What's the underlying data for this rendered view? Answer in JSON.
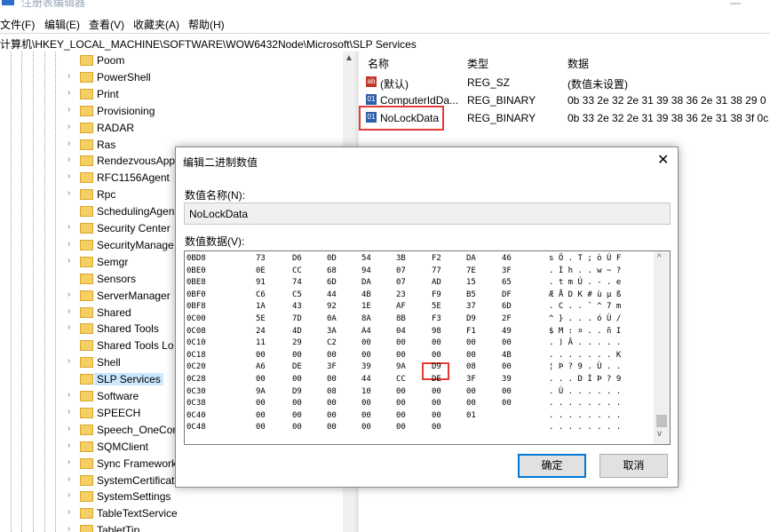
{
  "window": {
    "title": "注册表编辑器"
  },
  "menu": [
    "文件(F)",
    "编辑(E)",
    "查看(V)",
    "收藏夹(A)",
    "帮助(H)"
  ],
  "address": "计算机\\HKEY_LOCAL_MACHINE\\SOFTWARE\\WOW6432Node\\Microsoft\\SLP Services",
  "tree": {
    "items": [
      {
        "label": "Poom",
        "expand": ""
      },
      {
        "label": "PowerShell",
        "expand": "›"
      },
      {
        "label": "Print",
        "expand": "›"
      },
      {
        "label": "Provisioning",
        "expand": "›"
      },
      {
        "label": "RADAR",
        "expand": "›"
      },
      {
        "label": "Ras",
        "expand": "›"
      },
      {
        "label": "RendezvousApp",
        "expand": "›"
      },
      {
        "label": "RFC1156Agent",
        "expand": "›"
      },
      {
        "label": "Rpc",
        "expand": "›"
      },
      {
        "label": "SchedulingAgen",
        "expand": ""
      },
      {
        "label": "Security Center",
        "expand": "›"
      },
      {
        "label": "SecurityManage",
        "expand": "›"
      },
      {
        "label": "Semgr",
        "expand": "›"
      },
      {
        "label": "Sensors",
        "expand": ""
      },
      {
        "label": "ServerManager",
        "expand": "›"
      },
      {
        "label": "Shared",
        "expand": "›"
      },
      {
        "label": "Shared Tools",
        "expand": "›"
      },
      {
        "label": "Shared Tools Lo",
        "expand": ""
      },
      {
        "label": "Shell",
        "expand": "›"
      },
      {
        "label": "SLP Services",
        "expand": "",
        "selected": true
      },
      {
        "label": "Software",
        "expand": "›"
      },
      {
        "label": "SPEECH",
        "expand": "›"
      },
      {
        "label": "Speech_OneCor",
        "expand": "›"
      },
      {
        "label": "SQMClient",
        "expand": "›"
      },
      {
        "label": "Sync Framework",
        "expand": "›"
      },
      {
        "label": "SystemCertificat",
        "expand": "›"
      },
      {
        "label": "SystemSettings",
        "expand": "›"
      },
      {
        "label": "TableTextService",
        "expand": "›"
      },
      {
        "label": "TabletTip",
        "expand": "›"
      }
    ]
  },
  "values": {
    "headers": {
      "name": "名称",
      "type": "类型",
      "data": "数据"
    },
    "rows": [
      {
        "icon": "ab",
        "name": "(默认)",
        "type": "REG_SZ",
        "data": "(数值未设置)"
      },
      {
        "icon": "bin",
        "name": "ComputerIdDa...",
        "type": "REG_BINARY",
        "data": "0b 33 2e 32 2e 31 39 38 36 2e 31 38 29 0"
      },
      {
        "icon": "bin",
        "name": "NoLockData",
        "type": "REG_BINARY",
        "data": "0b 33 2e 32 2e 31 39 38 36 2e 31 38 3f 0c"
      }
    ]
  },
  "dialog": {
    "title": "编辑二进制数值",
    "close": "✕",
    "name_label": "数值名称(N):",
    "name_value": "NoLockData",
    "data_label": "数值数据(V):",
    "hex_rows": [
      {
        "addr": "0BD8",
        "bytes": [
          "73",
          "D6",
          "0D",
          "54",
          "3B",
          "F2",
          "DA",
          "46"
        ],
        "ascii": "s Ö . T ; ò Ú F"
      },
      {
        "addr": "0BE0",
        "bytes": [
          "0E",
          "CC",
          "68",
          "94",
          "07",
          "77",
          "7E",
          "3F"
        ],
        "ascii": ". Ì h . . w ~ ?"
      },
      {
        "addr": "0BE8",
        "bytes": [
          "91",
          "74",
          "6D",
          "DA",
          "07",
          "AD",
          "15",
          "65"
        ],
        "ascii": ". t m Ú . - . e"
      },
      {
        "addr": "0BF0",
        "bytes": [
          "C6",
          "C5",
          "44",
          "4B",
          "23",
          "F9",
          "B5",
          "DF"
        ],
        "ascii": "Æ Å D K # ù µ ß"
      },
      {
        "addr": "0BF8",
        "bytes": [
          "1A",
          "43",
          "92",
          "1E",
          "AF",
          "5E",
          "37",
          "6D"
        ],
        "ascii": ". C . . ¯ ^ 7 m"
      },
      {
        "addr": "0C00",
        "bytes": [
          "5E",
          "7D",
          "0A",
          "8A",
          "8B",
          "F3",
          "D9",
          "2F"
        ],
        "ascii": "^ } . . . ó Ù /"
      },
      {
        "addr": "0C08",
        "bytes": [
          "24",
          "4D",
          "3A",
          "A4",
          "04",
          "98",
          "F1",
          "49"
        ],
        "ascii": "$ M : ¤ . . ñ I"
      },
      {
        "addr": "0C10",
        "bytes": [
          "11",
          "29",
          "C2",
          "00",
          "00",
          "00",
          "00",
          "00"
        ],
        "ascii": ". ) Â . . . . ."
      },
      {
        "addr": "0C18",
        "bytes": [
          "00",
          "00",
          "00",
          "00",
          "00",
          "00",
          "00",
          "4B"
        ],
        "ascii": ". . . . . . . K"
      },
      {
        "addr": "0C20",
        "bytes": [
          "A6",
          "DE",
          "3F",
          "39",
          "9A",
          "D9",
          "08",
          "00"
        ],
        "ascii": "¦ Þ ? 9 . Ù . ."
      },
      {
        "addr": "0C28",
        "bytes": [
          "00",
          "00",
          "00",
          "44",
          "CC",
          "DE",
          "3F",
          "39"
        ],
        "ascii": ". . . D Ì Þ ? 9"
      },
      {
        "addr": "0C30",
        "bytes": [
          "9A",
          "D9",
          "08",
          "10",
          "00",
          "00",
          "00",
          "00"
        ],
        "ascii": ". Ù . . . . . ."
      },
      {
        "addr": "0C38",
        "bytes": [
          "00",
          "00",
          "00",
          "00",
          "00",
          "00",
          "00",
          "00"
        ],
        "ascii": ". . . . . . . ."
      },
      {
        "addr": "0C40",
        "bytes": [
          "00",
          "00",
          "00",
          "00",
          "00",
          "00",
          "01",
          ""
        ],
        "ascii": ". . . . . . . ."
      },
      {
        "addr": "0C48",
        "bytes": [
          "00",
          "00",
          "00",
          "00",
          "00",
          "00",
          "",
          ""
        ],
        "ascii": ". . . . . . . ."
      }
    ],
    "ok": "确定",
    "cancel": "取消"
  },
  "colors": {
    "highlight": "#e53935",
    "selection": "#cce8ff",
    "accent": "#0078d7"
  }
}
